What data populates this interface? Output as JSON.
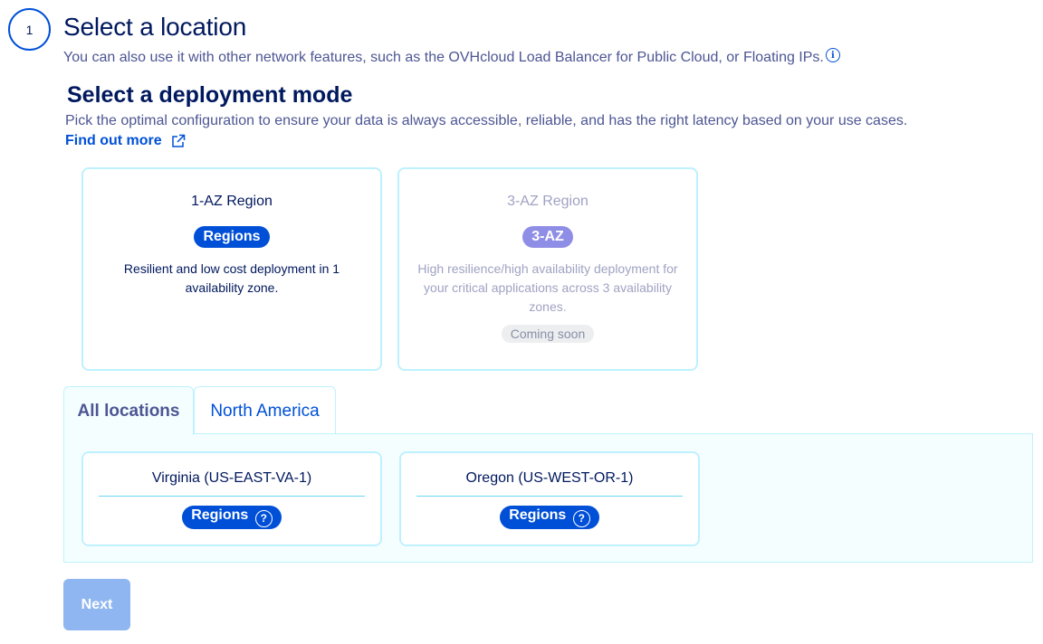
{
  "step": {
    "number": "1",
    "title": "Select a location",
    "description": "You can also use it with other network features, such as the OVHcloud Load Balancer for Public Cloud, or Floating IPs.",
    "info_icon": "info-icon",
    "info_glyph": "i"
  },
  "deployment": {
    "title": "Select a deployment mode",
    "description": "Pick the optimal configuration to ensure your data is always accessible, reliable, and has the right latency based on your use cases.",
    "find_out_more": "Find out more",
    "modes": [
      {
        "title": "1-AZ Region",
        "badge": "Regions",
        "text": "Resilient and low cost deployment in 1 availability zone."
      },
      {
        "title": "3-AZ Region",
        "badge": "3-AZ",
        "text": "High resilience/high availability deployment for your critical applications across 3 availability zones.",
        "status": "Coming soon"
      }
    ]
  },
  "tabs": [
    {
      "label": "All locations",
      "active": true
    },
    {
      "label": "North America",
      "active": false
    }
  ],
  "locations": [
    {
      "name": "Virginia (US-EAST-VA-1)",
      "badge": "Regions",
      "help_glyph": "?"
    },
    {
      "name": "Oregon (US-WEST-OR-1)",
      "badge": "Regions",
      "help_glyph": "?"
    }
  ],
  "next_label": "Next",
  "colors": {
    "primary": "#0050d7",
    "card_border": "#bef1ff",
    "panel_bg": "#f5feff",
    "disabled_button": "#8fb6f1",
    "three_az_badge": "#8f8ee6"
  }
}
